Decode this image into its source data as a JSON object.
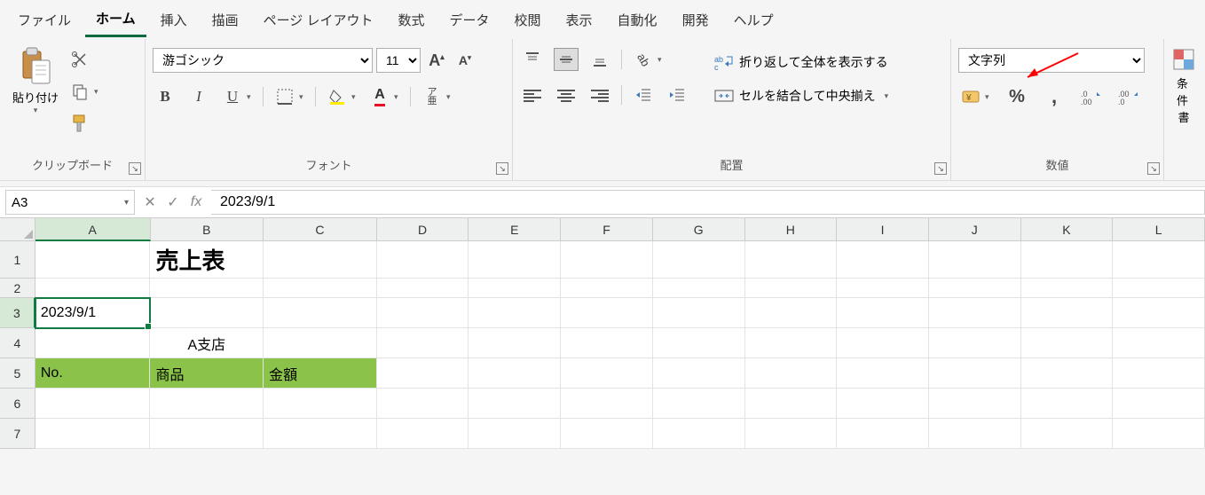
{
  "menu": {
    "file": "ファイル",
    "home": "ホーム",
    "insert": "挿入",
    "draw": "描画",
    "pageLayout": "ページ レイアウト",
    "formulas": "数式",
    "data": "データ",
    "review": "校閲",
    "view": "表示",
    "automate": "自動化",
    "developer": "開発",
    "help": "ヘルプ"
  },
  "ribbon": {
    "clipboard": {
      "paste": "貼り付け",
      "label": "クリップボード"
    },
    "font": {
      "name": "游ゴシック",
      "size": "11",
      "label": "フォント",
      "ruby": "ア\n亜"
    },
    "alignment": {
      "wrap": "折り返して全体を表示する",
      "merge": "セルを結合して中央揃え",
      "label": "配置"
    },
    "number": {
      "format": "文字列",
      "label": "数値"
    },
    "cond": {
      "label1": "条件",
      "label2": "書"
    }
  },
  "namebox": "A3",
  "formula": "2023/9/1",
  "columns": [
    "A",
    "B",
    "C",
    "D",
    "E",
    "F",
    "G",
    "H",
    "I",
    "J",
    "K",
    "L"
  ],
  "rows": [
    "1",
    "2",
    "3",
    "4",
    "5",
    "6",
    "7"
  ],
  "cells": {
    "title": "売上表",
    "a3": "2023/9/1",
    "b4": "A支店",
    "a5": "No.",
    "b5": "商品",
    "c5": "金額"
  }
}
